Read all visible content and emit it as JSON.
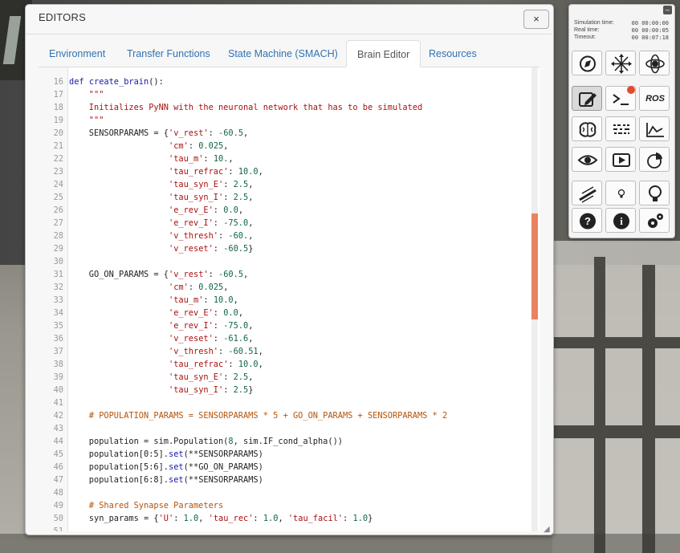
{
  "editor": {
    "title": "EDITORS",
    "close_label": "×",
    "tabs": [
      {
        "label": "Environment"
      },
      {
        "label": "Transfer Functions"
      },
      {
        "label": "State Machine (SMACH)"
      },
      {
        "label": "Brain Editor"
      },
      {
        "label": "Resources"
      }
    ],
    "active_tab": "Brain Editor"
  },
  "code_lines": [
    {
      "n": "16",
      "text": "def create_brain():"
    },
    {
      "n": "17",
      "text": "    \"\"\""
    },
    {
      "n": "18",
      "text": "    Initializes PyNN with the neuronal network that has to be simulated"
    },
    {
      "n": "19",
      "text": "    \"\"\""
    },
    {
      "n": "20",
      "text": "    SENSORPARAMS = {'v_rest': -60.5,"
    },
    {
      "n": "21",
      "text": "                    'cm': 0.025,"
    },
    {
      "n": "22",
      "text": "                    'tau_m': 10.,"
    },
    {
      "n": "23",
      "text": "                    'tau_refrac': 10.0,"
    },
    {
      "n": "24",
      "text": "                    'tau_syn_E': 2.5,"
    },
    {
      "n": "25",
      "text": "                    'tau_syn_I': 2.5,"
    },
    {
      "n": "26",
      "text": "                    'e_rev_E': 0.0,"
    },
    {
      "n": "27",
      "text": "                    'e_rev_I': -75.0,"
    },
    {
      "n": "28",
      "text": "                    'v_thresh': -60.,"
    },
    {
      "n": "29",
      "text": "                    'v_reset': -60.5}"
    },
    {
      "n": "30",
      "text": ""
    },
    {
      "n": "31",
      "text": "    GO_ON_PARAMS = {'v_rest': -60.5,"
    },
    {
      "n": "32",
      "text": "                    'cm': 0.025,"
    },
    {
      "n": "33",
      "text": "                    'tau_m': 10.0,"
    },
    {
      "n": "34",
      "text": "                    'e_rev_E': 0.0,"
    },
    {
      "n": "35",
      "text": "                    'e_rev_I': -75.0,"
    },
    {
      "n": "36",
      "text": "                    'v_reset': -61.6,"
    },
    {
      "n": "37",
      "text": "                    'v_thresh': -60.51,"
    },
    {
      "n": "38",
      "text": "                    'tau_refrac': 10.0,"
    },
    {
      "n": "39",
      "text": "                    'tau_syn_E': 2.5,"
    },
    {
      "n": "40",
      "text": "                    'tau_syn_I': 2.5}"
    },
    {
      "n": "41",
      "text": ""
    },
    {
      "n": "42",
      "text": "    # POPULATION_PARAMS = SENSORPARAMS * 5 + GO_ON_PARAMS + SENSORPARAMS * 2"
    },
    {
      "n": "43",
      "text": ""
    },
    {
      "n": "44",
      "text": "    population = sim.Population(8, sim.IF_cond_alpha())"
    },
    {
      "n": "45",
      "text": "    population[0:5].set(**SENSORPARAMS)"
    },
    {
      "n": "46",
      "text": "    population[5:6].set(**GO_ON_PARAMS)"
    },
    {
      "n": "47",
      "text": "    population[6:8].set(**SENSORPARAMS)"
    },
    {
      "n": "48",
      "text": ""
    },
    {
      "n": "49",
      "text": "    # Shared Synapse Parameters"
    },
    {
      "n": "50",
      "text": "    syn_params = {'U': 1.0, 'tau_rec': 1.0, 'tau_facil': 1.0}"
    },
    {
      "n": "51",
      "text": ""
    }
  ],
  "control_panel": {
    "simulation_time_label": "Simulation time:",
    "simulation_time": "00 00:00:00",
    "real_time_label": "Real time:",
    "real_time": "00 00:00:05",
    "timeout_label": "Timeout:",
    "timeout": "00 00:07:18",
    "ros_label": "ROS",
    "minimize_label": "–"
  },
  "colors": {
    "tab_link": "#3072b3",
    "scrollbar_thumb": "#e8825f",
    "notification_badge": "#e64a2e"
  }
}
